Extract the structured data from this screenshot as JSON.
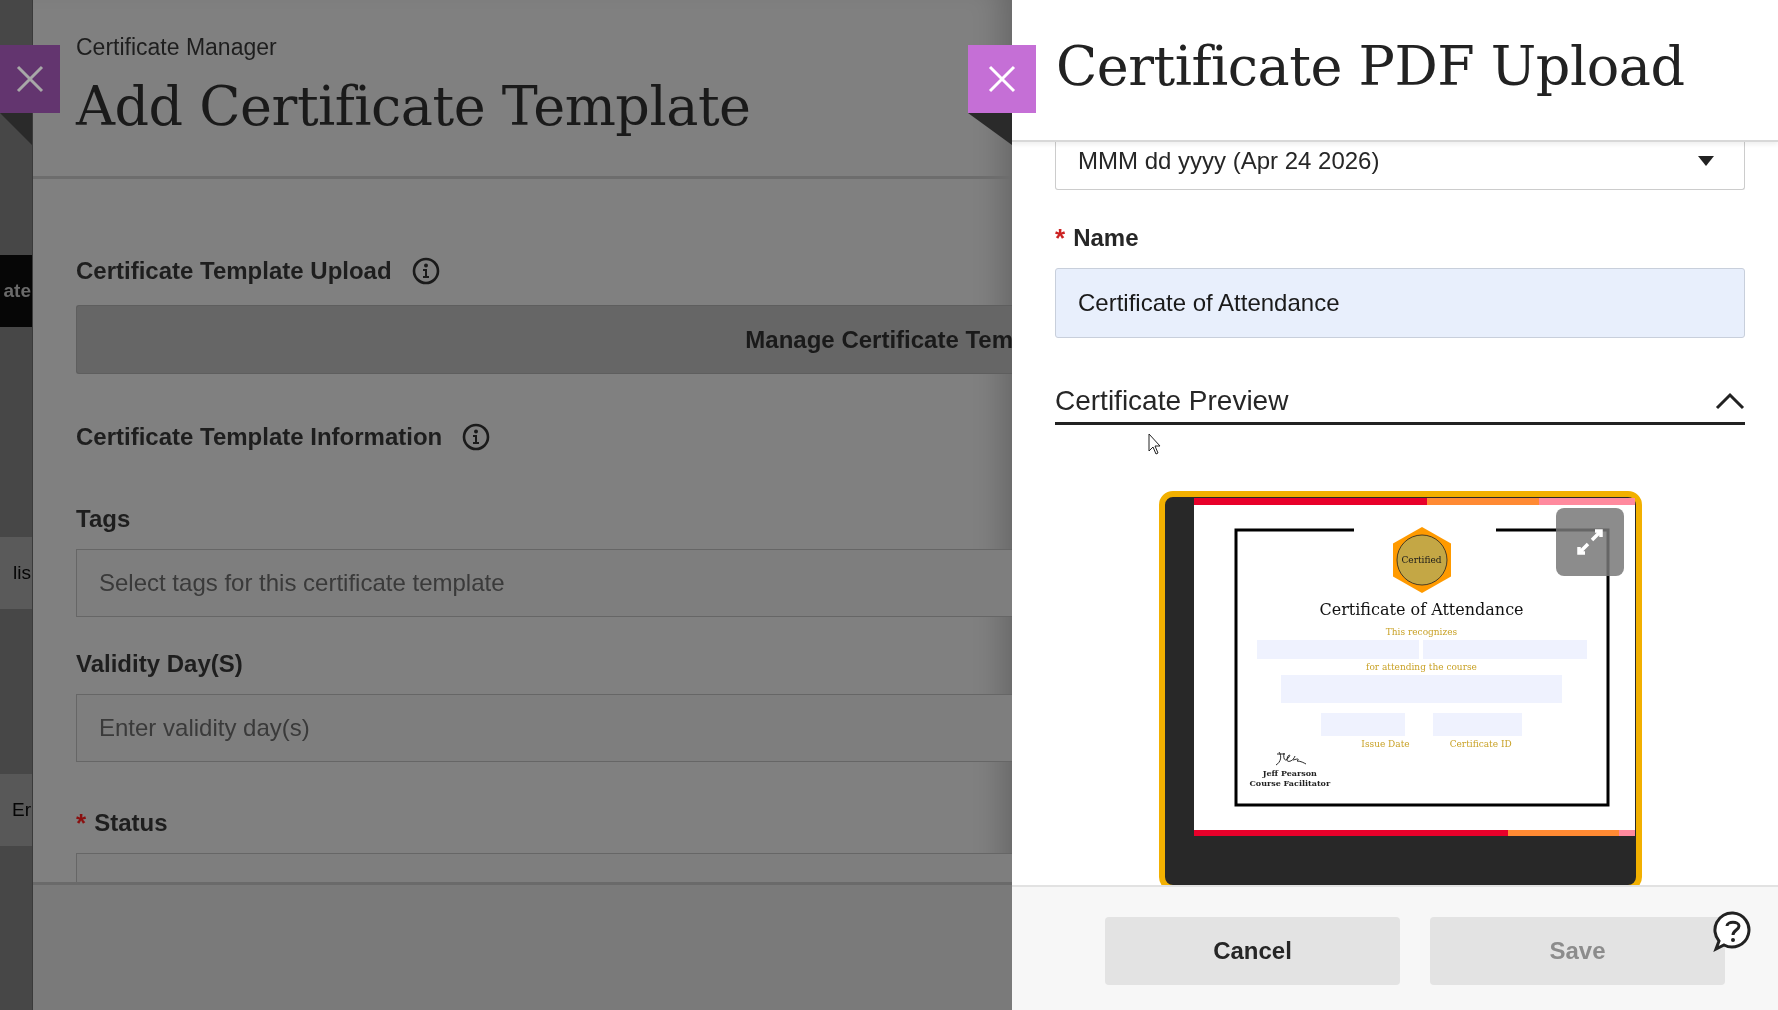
{
  "background_strip": {
    "texts": [
      "ate",
      "lis",
      "Er"
    ]
  },
  "main_panel": {
    "breadcrumb": "Certificate Manager",
    "title": "Add Certificate Template",
    "upload": {
      "label": "Certificate Template Upload",
      "button": "Manage Certificate Tem"
    },
    "info": {
      "label": "Certificate Template Information"
    },
    "fields": [
      {
        "label": "Tags",
        "placeholder": "Select tags for this certificate template"
      },
      {
        "label": "Validity Day(S)",
        "placeholder": "Enter validity day(s)"
      },
      {
        "label": "Status",
        "required_mark": "*"
      }
    ]
  },
  "side_panel": {
    "title": "Certificate PDF Upload",
    "date_format": {
      "value": "MMM dd yyyy (Apr 24 2026)"
    },
    "name_field": {
      "label": "Name",
      "required_mark": "*",
      "value": "Certificate of Attendance"
    },
    "preview": {
      "heading": "Certificate Preview",
      "expanded": true,
      "certificate": {
        "badge": "Certified",
        "title": "Certificate of Attendance",
        "recognizes": "This recognizes",
        "attending": "for attending the course",
        "issue_date": "Issue Date",
        "certificate_id": "Certificate ID",
        "signer": "Jeff Pearson",
        "signer_role": "Course Facilitator"
      }
    },
    "buttons": [
      {
        "label": "Cancel",
        "disabled": false
      },
      {
        "label": "Save",
        "disabled": true
      }
    ]
  }
}
